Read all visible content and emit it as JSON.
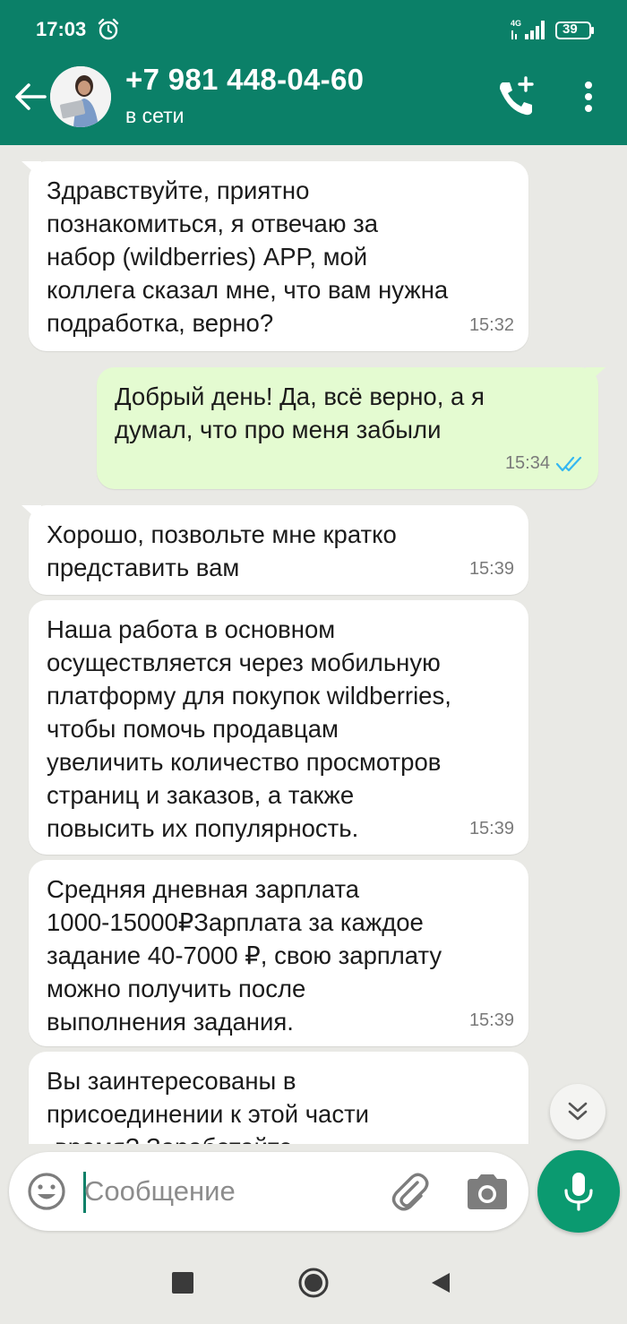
{
  "status_bar": {
    "time": "17:03",
    "network": "4G",
    "battery": "39"
  },
  "header": {
    "contact_name": "+7 981 448-04-60",
    "contact_status": "в сети",
    "icons": [
      "back-arrow-icon",
      "avatar",
      "add-call-icon",
      "more-vert-icon"
    ]
  },
  "messages": [
    {
      "direction": "in",
      "text": "Здравствуйте, приятно\nпознакомиться, я отвечаю за\nнабор (wildberries) APP, мой\nколлега сказал мне, что вам нужна\nподработка, верно?",
      "time": "15:32"
    },
    {
      "direction": "out",
      "text": "Добрый день! Да, всё верно, а я\nдумал, что про меня забыли",
      "time": "15:34",
      "read": true
    },
    {
      "direction": "in",
      "text": "Хорошо, позвольте мне кратко\nпредставить вам",
      "time": "15:39"
    },
    {
      "direction": "in",
      "text": "Наша работа в основном\nосуществляется через мобильную\nплатформу для покупок wildberries,\nчтобы помочь продавцам\nувеличить количество просмотров\nстраниц и заказов, а также\nповысить их популярность.",
      "time": "15:39"
    },
    {
      "direction": "in",
      "text": "Средняя дневная зарплата\n1000-15000₽Зарплата за каждое\nзадание 40-7000 ₽, свою зарплату\nможно получить после\nвыполнения задания.",
      "time": "15:39"
    },
    {
      "direction": "in",
      "text": "Вы заинтересованы в\nприсоединении к этой части\n-время? Заработайте",
      "time": ""
    }
  ],
  "input": {
    "placeholder": "Сообщение"
  },
  "colors": {
    "header": "#0b8068",
    "outgoing_bubble": "#e4fbd1",
    "incoming_bubble": "#ffffff",
    "chat_background": "#e9e9e5",
    "mic_button": "#0b9a70",
    "read_ticks": "#34b7f1"
  }
}
